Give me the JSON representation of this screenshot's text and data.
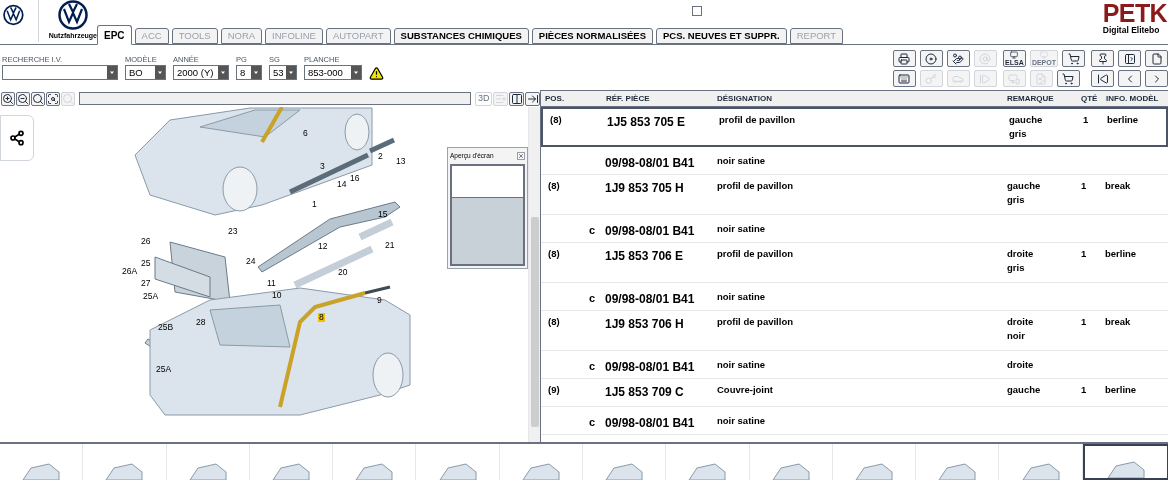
{
  "header": {
    "brand_sub": "Nutzfahrzeuge",
    "stocks_checked": false,
    "product": "PETK",
    "product_sub": "Digital Elitebo"
  },
  "tabs": [
    {
      "label": "EPC",
      "selected": true,
      "disabled": false
    },
    {
      "label": "ACC",
      "selected": false,
      "disabled": true
    },
    {
      "label": "TOOLS",
      "selected": false,
      "disabled": true
    },
    {
      "label": "NORA",
      "selected": false,
      "disabled": true
    },
    {
      "label": "INFOLINE",
      "selected": false,
      "disabled": true
    },
    {
      "label": "AUTOPART",
      "selected": false,
      "disabled": true
    },
    {
      "label": "SUBSTANCES CHIMIQUES",
      "selected": false,
      "disabled": false
    },
    {
      "label": "PIÈCES NORMALISÉES",
      "selected": false,
      "disabled": false
    },
    {
      "label": "PCS. NEUVES ET SUPPR.",
      "selected": false,
      "disabled": false
    },
    {
      "label": "REPORT",
      "selected": false,
      "disabled": true
    }
  ],
  "fields": [
    {
      "label": "RECHERCHE I.V."
    },
    {
      "label": "MODÈLE",
      "value": "BO"
    },
    {
      "label": "ANNÉE",
      "value": "2000 (Y)"
    },
    {
      "label": "PG",
      "value": "8"
    },
    {
      "label": "SG",
      "value": "53"
    },
    {
      "label": "PLANCHE",
      "value": "853-000"
    }
  ],
  "toolbar_groups": [
    [
      [
        {
          "kind": "print",
          "disabled": false
        },
        {
          "kind": "disc",
          "disabled": false
        },
        {
          "kind": "hand",
          "disabled": false
        },
        {
          "kind": "at",
          "disabled": true
        }
      ],
      [
        {
          "kind": "keyboard",
          "disabled": false
        },
        {
          "kind": "key",
          "disabled": true
        },
        {
          "kind": "car",
          "disabled": true
        },
        {
          "kind": "play",
          "disabled": true
        }
      ]
    ],
    [
      [
        {
          "kind": "monitor",
          "label": "ELSA",
          "disabled": false
        },
        {
          "kind": "monitor",
          "label": "DEPOT",
          "disabled": true
        },
        {
          "kind": "cart",
          "disabled": false
        }
      ],
      [
        {
          "kind": "devices",
          "disabled": true
        },
        {
          "kind": "car-doc",
          "disabled": true
        },
        {
          "kind": "cart",
          "disabled": false
        }
      ]
    ],
    [
      [
        {
          "kind": "pin",
          "disabled": false
        },
        {
          "kind": "page-left",
          "disabled": false
        },
        {
          "kind": "page",
          "disabled": false
        }
      ],
      [
        {
          "kind": "first",
          "disabled": false
        },
        {
          "kind": "prev",
          "disabled": false
        },
        {
          "kind": "next",
          "disabled": false
        }
      ]
    ]
  ],
  "viewer": {
    "zoom_tools": [
      {
        "kind": "zoom-in",
        "disabled": false
      },
      {
        "kind": "zoom-out",
        "disabled": false
      },
      {
        "kind": "zoom-fit",
        "disabled": false
      },
      {
        "kind": "zoom-area",
        "disabled": false
      },
      {
        "kind": "search",
        "disabled": true
      }
    ],
    "view_tools": [
      {
        "kind": "threed",
        "label": "3D",
        "disabled": true
      },
      {
        "kind": "list",
        "disabled": true
      },
      {
        "kind": "panel",
        "disabled": false
      },
      {
        "kind": "arrow",
        "disabled": false
      }
    ],
    "callouts": [
      "6",
      "3",
      "2",
      "13",
      "16",
      "14",
      "1",
      "15",
      "23",
      "24",
      "26",
      "25",
      "26A",
      "27",
      "12",
      "21",
      "20",
      "11",
      "10",
      "25A",
      "28",
      "25B",
      "25A",
      "8",
      "9"
    ],
    "preview": {
      "title": "Aperçu d'écran"
    }
  },
  "table": {
    "columns": [
      "POS.",
      "RÉF. PIÈCE",
      "DÉSIGNATION",
      "REMARQUE",
      "QTÉ",
      "INFO. MODÈL"
    ],
    "rows": [
      {
        "kind": "part",
        "pos": "(8)",
        "ref": "1J5 853 705 E",
        "designation": "profil de pavillon",
        "remarks": [
          "gauche",
          "gris"
        ],
        "qty": "1",
        "info": "berline",
        "selected": true
      },
      {
        "kind": "variant",
        "ref": "09/98-08/01 B41",
        "designation": "noir satine",
        "selected": false
      },
      {
        "kind": "part",
        "pos": "(8)",
        "ref": "1J9 853 705 H",
        "designation": "profil de pavillon",
        "remarks": [
          "gauche",
          "gris"
        ],
        "qty": "1",
        "info": "break",
        "selected": false
      },
      {
        "kind": "variant",
        "prefix": "c",
        "ref": "09/98-08/01 B41",
        "designation": "noir satine",
        "selected": false
      },
      {
        "kind": "part",
        "pos": "(8)",
        "ref": "1J5 853 706 E",
        "designation": "profil de pavillon",
        "remarks": [
          "droite",
          "gris"
        ],
        "qty": "1",
        "info": "berline",
        "selected": false
      },
      {
        "kind": "variant",
        "prefix": "c",
        "ref": "09/98-08/01 B41",
        "designation": "noir satine",
        "selected": false
      },
      {
        "kind": "part",
        "pos": "(8)",
        "ref": "1J9 853 706 H",
        "designation": "profil de pavillon",
        "remarks": [
          "droite",
          "noir"
        ],
        "qty": "1",
        "info": "break",
        "selected": false
      },
      {
        "kind": "variant",
        "prefix": "c",
        "ref": "09/98-08/01 B41",
        "designation": "noir satine",
        "remarks": [
          "droite"
        ],
        "selected": false
      },
      {
        "kind": "part",
        "pos": "(9)",
        "ref": "1J5 853 709 C",
        "designation": "Couvre-joint",
        "remarks": [
          "gauche"
        ],
        "qty": "1",
        "info": "berline",
        "selected": false
      },
      {
        "kind": "variant",
        "prefix": "c",
        "ref": "09/98-08/01 B41",
        "designation": "noir satine",
        "selected": false
      }
    ]
  },
  "thumbnails": [
    {
      "selected": false
    },
    {
      "selected": false
    },
    {
      "selected": false
    },
    {
      "selected": false
    },
    {
      "selected": false
    },
    {
      "selected": false
    },
    {
      "selected": false
    },
    {
      "selected": false
    },
    {
      "selected": false
    },
    {
      "selected": false
    },
    {
      "selected": false
    },
    {
      "selected": false
    },
    {
      "selected": false
    },
    {
      "selected": true
    }
  ]
}
